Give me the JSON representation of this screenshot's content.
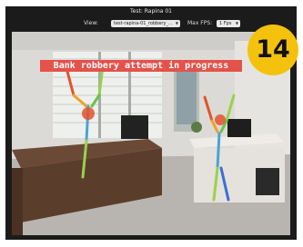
{
  "window": {
    "title": "Test: Rapina 01"
  },
  "toolbar": {
    "view_label": "View:",
    "view_value": "test-rapina-01_robbery_...",
    "fps_label": "Max FPS:",
    "fps_value": "1 Fps"
  },
  "overlay": {
    "alert_text": "Bank robbery attempt in progress",
    "alert_color": "#e3524b",
    "badge_number": "14",
    "badge_color": "#f4c20d"
  },
  "icons": {
    "dropdown": "chevron-down-icon"
  }
}
